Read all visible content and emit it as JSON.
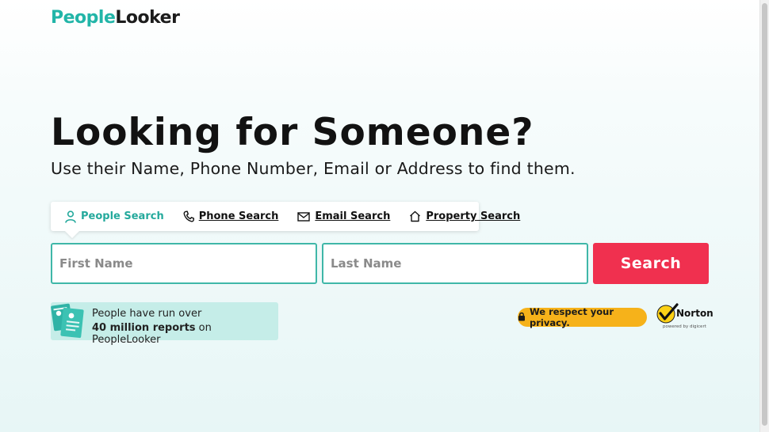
{
  "logo": {
    "part1": "People",
    "part2": "Looker"
  },
  "hero": {
    "title": "Looking for Someone?",
    "subtitle": "Use their Name, Phone Number, Email or Address to find them."
  },
  "tabs": [
    {
      "label": "People Search",
      "icon": "person-icon",
      "active": true
    },
    {
      "label": "Phone Search",
      "icon": "phone-icon",
      "active": false
    },
    {
      "label": "Email Search",
      "icon": "envelope-icon",
      "active": false
    },
    {
      "label": "Property Search",
      "icon": "house-icon",
      "active": false
    }
  ],
  "form": {
    "first_name_placeholder": "First Name",
    "last_name_placeholder": "Last Name",
    "search_label": "Search"
  },
  "reports": {
    "line1": "People have run over",
    "line2_bold": "40 million reports",
    "line2_rest": " on PeopleLooker"
  },
  "trust": {
    "privacy_text": "We respect your privacy.",
    "norton_name": "Norton",
    "norton_sub": "powered by digicert"
  },
  "colors": {
    "accent_teal": "#24a99c",
    "search_button": "#f0304f",
    "privacy_badge": "#f6b21a"
  }
}
